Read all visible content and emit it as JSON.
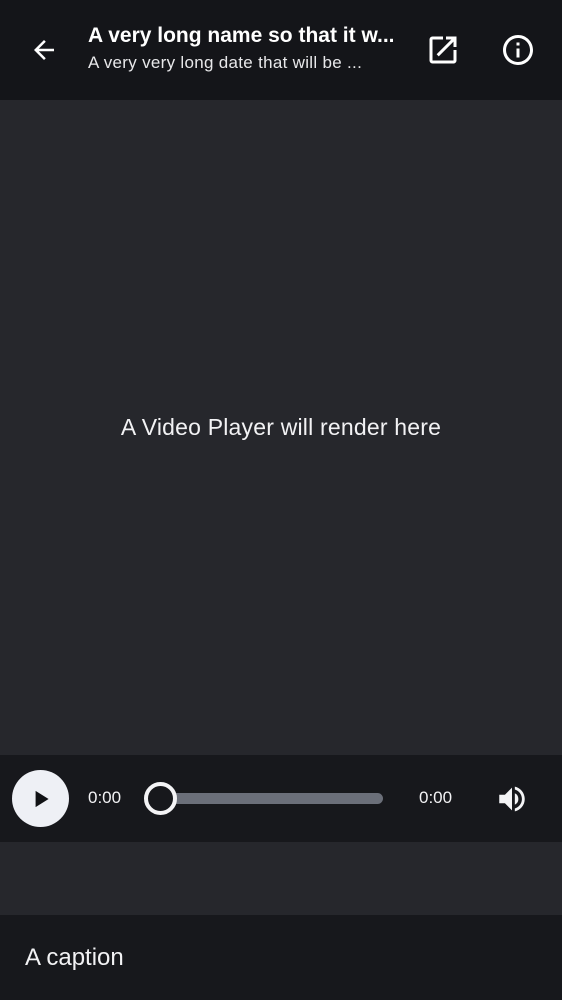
{
  "header": {
    "back_icon": "arrow-left-icon",
    "title": "A very long name so that it w...",
    "subtitle": "A very very long date that will be ...",
    "open_icon": "open-in-new-icon",
    "info_icon": "info-icon"
  },
  "video": {
    "placeholder": "A Video Player will render here"
  },
  "controls": {
    "play_icon": "play-icon",
    "current_time": "0:00",
    "duration": "0:00",
    "progress": 0,
    "volume_icon": "volume-up-icon"
  },
  "caption": {
    "text": "A caption"
  },
  "colors": {
    "header_bg": "#141519",
    "content_bg": "#26272c",
    "controls_bg": "#17181c",
    "accent_light": "#eef0f5",
    "track": "#6b6f79"
  }
}
